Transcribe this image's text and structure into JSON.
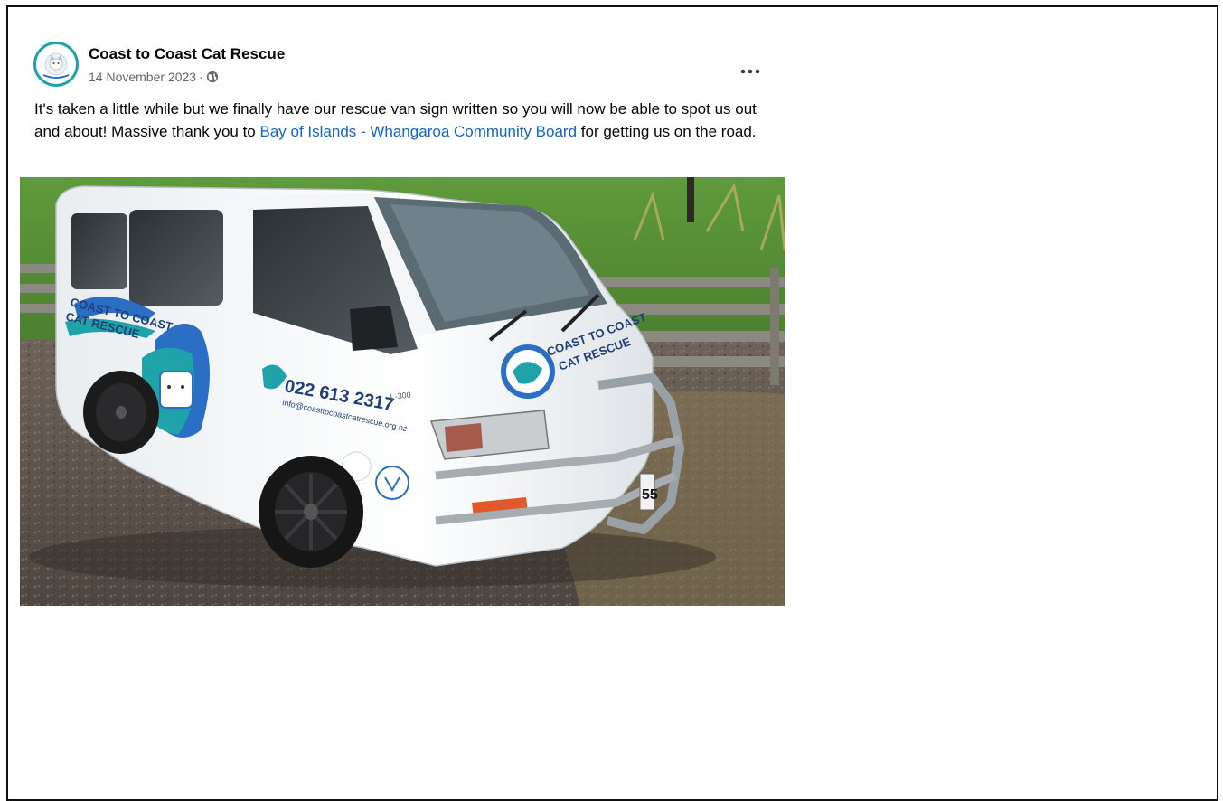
{
  "post": {
    "page_name": "Coast to Coast Cat Rescue",
    "date": "14 November 2023",
    "separator": "·",
    "privacy_icon": "globe-icon",
    "more_icon": "more-options-icon",
    "text_before_link": "It's taken a little while but we finally have our rescue van sign written so you will now be able to spot us out and about! Massive thank you to ",
    "link_text": "Bay of Islands - Whangaroa Community Board",
    "text_after_link": " for getting us on the road."
  },
  "image": {
    "van_side_text": "COAST TO COAST CAT RESCUE",
    "van_side_line1": "COAST TO COAST",
    "van_side_line2": "CAT RESCUE",
    "van_phone": "022 613 2317",
    "van_email": "info@coasttocoastcatrescue.org.nz",
    "van_model": "L-300",
    "van_hood_line1": "COAST TO COAST",
    "van_hood_line2": "CAT RESCUE",
    "plate_fragment": "55"
  },
  "colors": {
    "link": "#1463c8",
    "text": "#050505",
    "meta": "#65676b",
    "logo_teal": "#1fa3a8",
    "logo_blue": "#2a6fc4"
  }
}
